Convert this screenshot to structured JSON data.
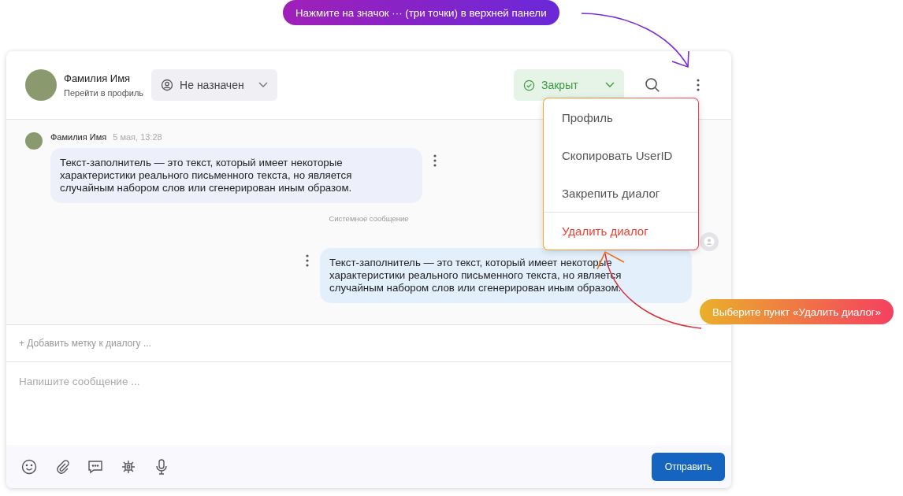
{
  "header": {
    "contact": {
      "name": "Фамилия Имя",
      "link": "Перейти в профиль"
    },
    "assignee": {
      "label": "Не назначен"
    },
    "status": {
      "label": "Закрыт"
    }
  },
  "messages": [
    {
      "kind": "incoming",
      "author": "Фамилия Имя",
      "time": "5 мая, 13:28",
      "text": "Текст-заполнитель — это текст, который имеет некоторые характеристики реального письменного текста, но является случайным набором слов или сгенерирован иным образом."
    },
    {
      "kind": "system",
      "text": "Системное сообщение"
    },
    {
      "kind": "outgoing",
      "text": "Текст-заполнитель — это текст, который имеет некоторые характеристики реального письменного текста, но является случайным набором слов или сгенерирован иным образом."
    }
  ],
  "tag_prompt": "+ Добавить метку к диалогу ...",
  "composer": {
    "placeholder": "Напишите сообщение ..."
  },
  "send_button": "Отправить",
  "menu": {
    "items": [
      {
        "label": "Профиль",
        "kind": "normal"
      },
      {
        "label": "Скопировать UserID",
        "kind": "normal"
      },
      {
        "label": "Закрепить диалог",
        "kind": "normal"
      },
      {
        "label": "Удалить диалог",
        "kind": "danger"
      }
    ]
  },
  "callouts": [
    {
      "kind": "top",
      "text": "Нажмите на значок ··· (три точки) в верхней панели"
    },
    {
      "kind": "side",
      "text": "Выберите пункт «Удалить диалог»"
    }
  ]
}
